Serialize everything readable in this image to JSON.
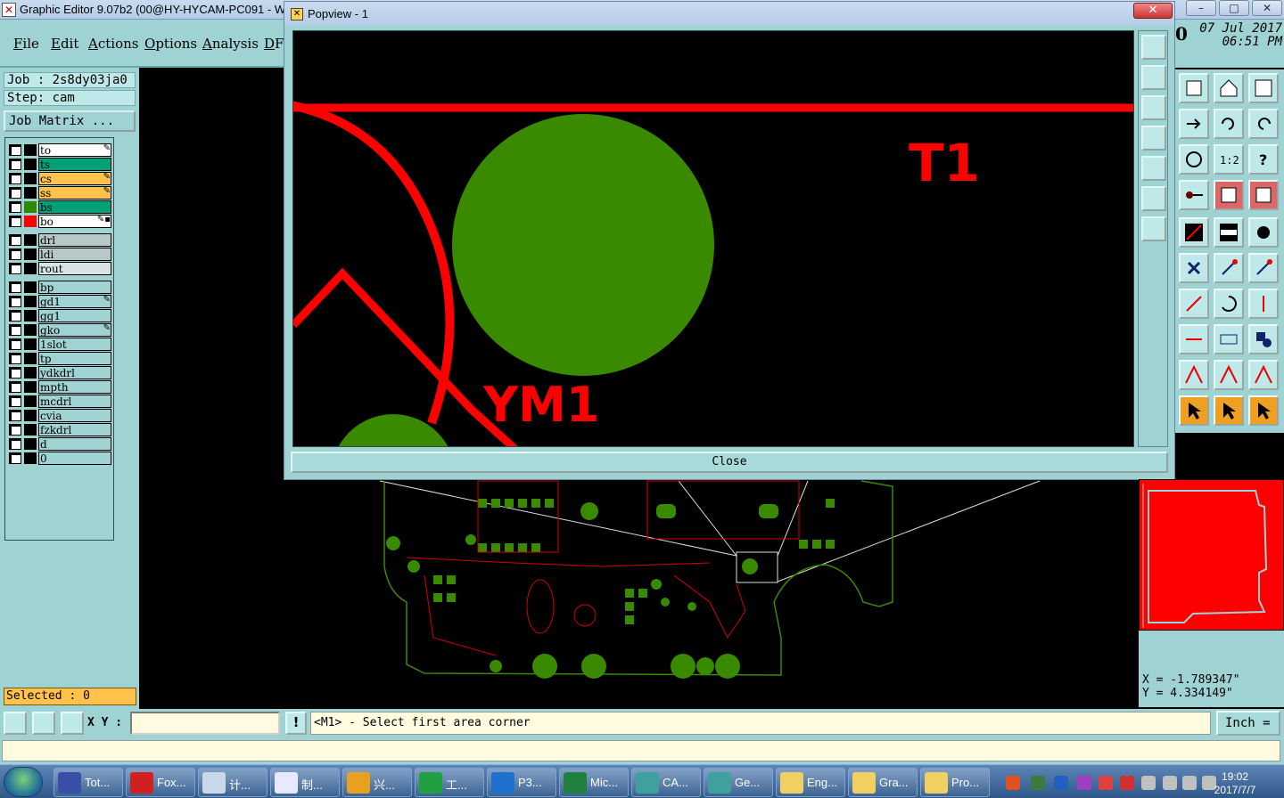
{
  "main_window": {
    "title": "Graphic Editor 9.07b2 (00@HY-HYCAM-PC091 - W",
    "controls": [
      "–",
      "□",
      "✕"
    ]
  },
  "menu": [
    "File",
    "Edit",
    "Actions",
    "Options",
    "Analysis",
    "DF"
  ],
  "clock_panel": {
    "zero": "0",
    "date": "07 Jul 2017",
    "time": "06:51 PM"
  },
  "job": {
    "job_line": "Job : 2s8dy03ja0",
    "step_line": "Step: cam",
    "matrix_button": "Job Matrix ..."
  },
  "layers": [
    {
      "name": "to",
      "bg": "#ffffff",
      "swatch": "#000000",
      "mark": "✎"
    },
    {
      "name": "ts",
      "bg": "#00a07a",
      "swatch": "#000000",
      "mark": ""
    },
    {
      "name": "cs",
      "bg": "#ffc24d",
      "swatch": "#000000",
      "mark": "✎"
    },
    {
      "name": "ss",
      "bg": "#ffc24d",
      "swatch": "#000000",
      "mark": "✎"
    },
    {
      "name": "bs",
      "bg": "#00a07a",
      "swatch": "#2e8b00",
      "mark": ""
    },
    {
      "name": "bo",
      "bg": "#ffffff",
      "swatch": "#ff0000",
      "mark": "✎▪"
    },
    {
      "name": "drl",
      "bg": "#b8c8c8",
      "swatch": "#000000",
      "mark": ""
    },
    {
      "name": "ldi",
      "bg": "#b8c8c8",
      "swatch": "#000000",
      "mark": ""
    },
    {
      "name": "rout",
      "bg": "#d8e4e4",
      "swatch": "#000000",
      "mark": ""
    },
    {
      "name": "bp",
      "bg": "#9fd3d3",
      "swatch": "#000000",
      "mark": ""
    },
    {
      "name": "gd1",
      "bg": "#9fd3d3",
      "swatch": "#000000",
      "mark": "✎"
    },
    {
      "name": "gg1",
      "bg": "#9fd3d3",
      "swatch": "#000000",
      "mark": ""
    },
    {
      "name": "gko",
      "bg": "#9fd3d3",
      "swatch": "#000000",
      "mark": "✎"
    },
    {
      "name": "1slot",
      "bg": "#9fd3d3",
      "swatch": "#000000",
      "mark": ""
    },
    {
      "name": "tp",
      "bg": "#9fd3d3",
      "swatch": "#000000",
      "mark": ""
    },
    {
      "name": "ydkdrl",
      "bg": "#9fd3d3",
      "swatch": "#000000",
      "mark": ""
    },
    {
      "name": "mpth",
      "bg": "#9fd3d3",
      "swatch": "#000000",
      "mark": ""
    },
    {
      "name": "mcdrl",
      "bg": "#9fd3d3",
      "swatch": "#000000",
      "mark": ""
    },
    {
      "name": "cvia",
      "bg": "#9fd3d3",
      "swatch": "#000000",
      "mark": ""
    },
    {
      "name": "fzkdrl",
      "bg": "#9fd3d3",
      "swatch": "#000000",
      "mark": ""
    },
    {
      "name": "d",
      "bg": "#9fd3d3",
      "swatch": "#000000",
      "mark": ""
    },
    {
      "name": "0",
      "bg": "#9fd3d3",
      "swatch": "#000000",
      "mark": ""
    }
  ],
  "selected": "Selected : 0",
  "popview": {
    "title": "Popview - 1",
    "close_x": "✕",
    "close_button": "Close",
    "label_t1": "T1",
    "label_ym1": "YM1"
  },
  "coords": {
    "x": "X = -1.789347\"",
    "y": "Y = 4.334149\""
  },
  "status": {
    "xy_label": "X Y :",
    "xy_value": "",
    "warn": "!",
    "prompt": "<M1> - Select first area corner",
    "unit": "Inch ="
  },
  "taskbar": {
    "tasks": [
      {
        "label": "Tot...",
        "color": "#3a4fa8"
      },
      {
        "label": "Fox...",
        "color": "#d02020"
      },
      {
        "label": "计...",
        "color": "#c8d8e8"
      },
      {
        "label": "制...",
        "color": "#e8e8ff"
      },
      {
        "label": "兴...",
        "color": "#e8a020"
      },
      {
        "label": "工...",
        "color": "#20a040"
      },
      {
        "label": "P3...",
        "color": "#2070d0"
      },
      {
        "label": "Mic...",
        "color": "#208040"
      },
      {
        "label": "CA...",
        "color": "#40a0a0"
      },
      {
        "label": "Ge...",
        "color": "#40a0a0"
      },
      {
        "label": "Eng...",
        "color": "#f0d060"
      },
      {
        "label": "Gra...",
        "color": "#f0d060"
      },
      {
        "label": "Pro...",
        "color": "#f0d060"
      }
    ],
    "clock_time": "19:02",
    "clock_date": "2017/7/7"
  },
  "colors": {
    "panel": "#9fd3d3",
    "copper_green": "#3a8a00",
    "trace_red": "#ff0000"
  }
}
